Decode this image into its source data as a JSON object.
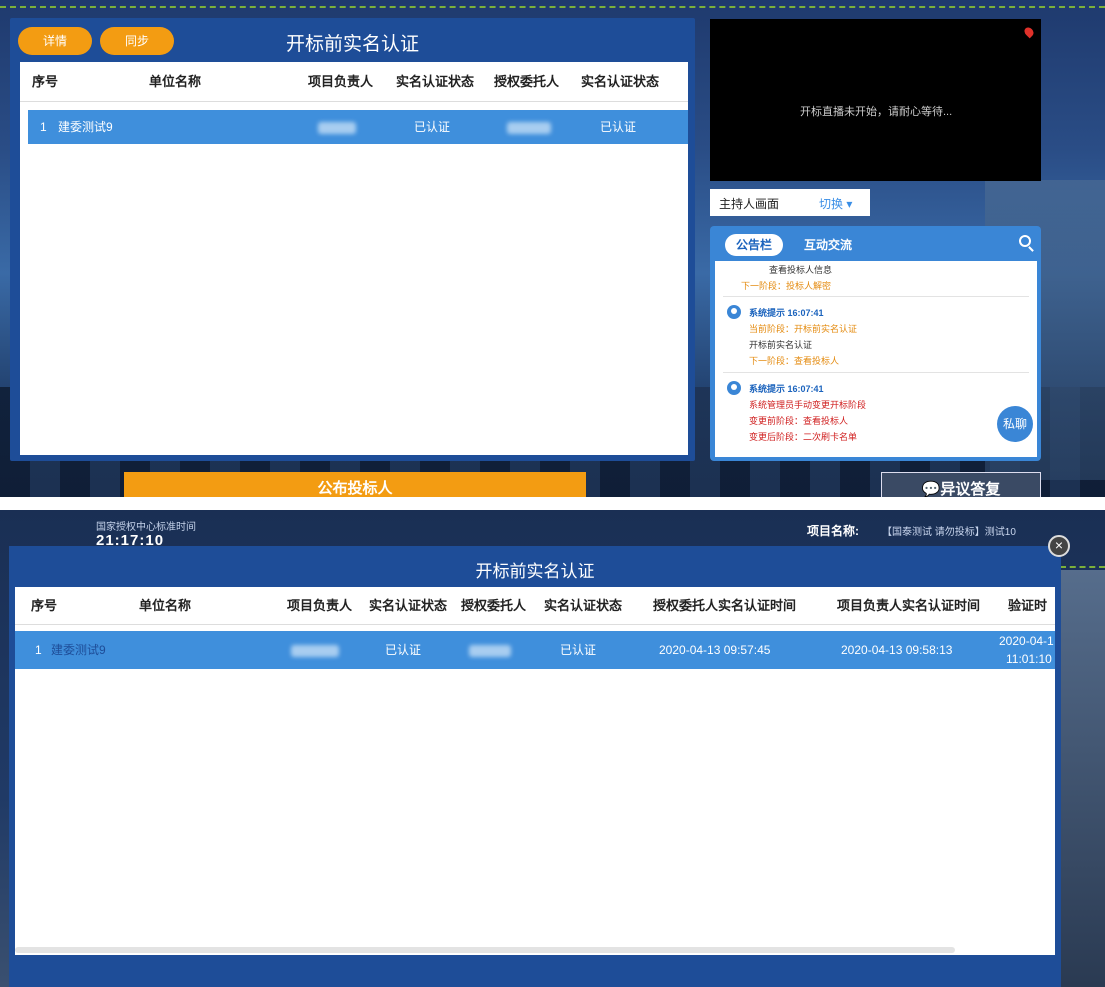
{
  "top": {
    "panel": {
      "detail_label": "详情",
      "sync_label": "同步",
      "title": "开标前实名认证",
      "columns": [
        "序号",
        "单位名称",
        "项目负责人",
        "实名认证状态",
        "授权委托人",
        "实名认证状态"
      ],
      "row": {
        "index": "1",
        "unit": "建委测试9",
        "status1": "已认证",
        "status2": "已认证"
      }
    },
    "video": {
      "message": "开标直播未开始，请耐心等待..."
    },
    "host": {
      "label": "主持人画面",
      "switch_label": "切换"
    },
    "board": {
      "tab_active": "公告栏",
      "tab_other": "互动交流",
      "entries": [
        {
          "title": "",
          "lines": [
            {
              "text": "查看投标人信息",
              "tone": "dark"
            },
            {
              "text": "下一阶段：投标人解密",
              "tone": "orange"
            }
          ]
        },
        {
          "title": "系统提示 16:07:41",
          "lines": [
            {
              "text": "当前阶段：开标前实名认证",
              "tone": "orange"
            },
            {
              "text": "开标前实名认证",
              "tone": "dark"
            },
            {
              "text": "下一阶段：查看投标人",
              "tone": "orange"
            }
          ]
        },
        {
          "title": "系统提示 16:07:41",
          "lines": [
            {
              "text": "系统管理员手动变更开标阶段",
              "tone": "red"
            },
            {
              "text": "变更前阶段：查看投标人",
              "tone": "red"
            },
            {
              "text": "变更后阶段：二次刷卡名单",
              "tone": "red"
            }
          ]
        }
      ],
      "chat_label": "私聊"
    },
    "publish_label": "公布投标人",
    "dissent_label": "异议答复"
  },
  "bottom": {
    "time_label": "国家授权中心标准时间",
    "clock": "21:17:10",
    "project_label": "项目名称:",
    "project_value": "【国泰测试 请勿投标】测试10",
    "modal": {
      "title": "开标前实名认证",
      "columns": [
        "序号",
        "单位名称",
        "项目负责人",
        "实名认证状态",
        "授权委托人",
        "实名认证状态",
        "授权委托人实名认证时间",
        "项目负责人实名认证时间",
        "验证时间"
      ],
      "row": {
        "index": "1",
        "unit": "建委测试9",
        "status1": "已认证",
        "status2": "已认证",
        "agent_time": "2020-04-13 09:57:45",
        "leader_time": "2020-04-13 09:58:13",
        "verify_date": "2020-04-1",
        "verify_time": "11:01:10"
      }
    }
  },
  "colors": {
    "panel_blue": "#1e4d98",
    "row_blue": "#3f8fdc",
    "orange": "#f39c12"
  }
}
